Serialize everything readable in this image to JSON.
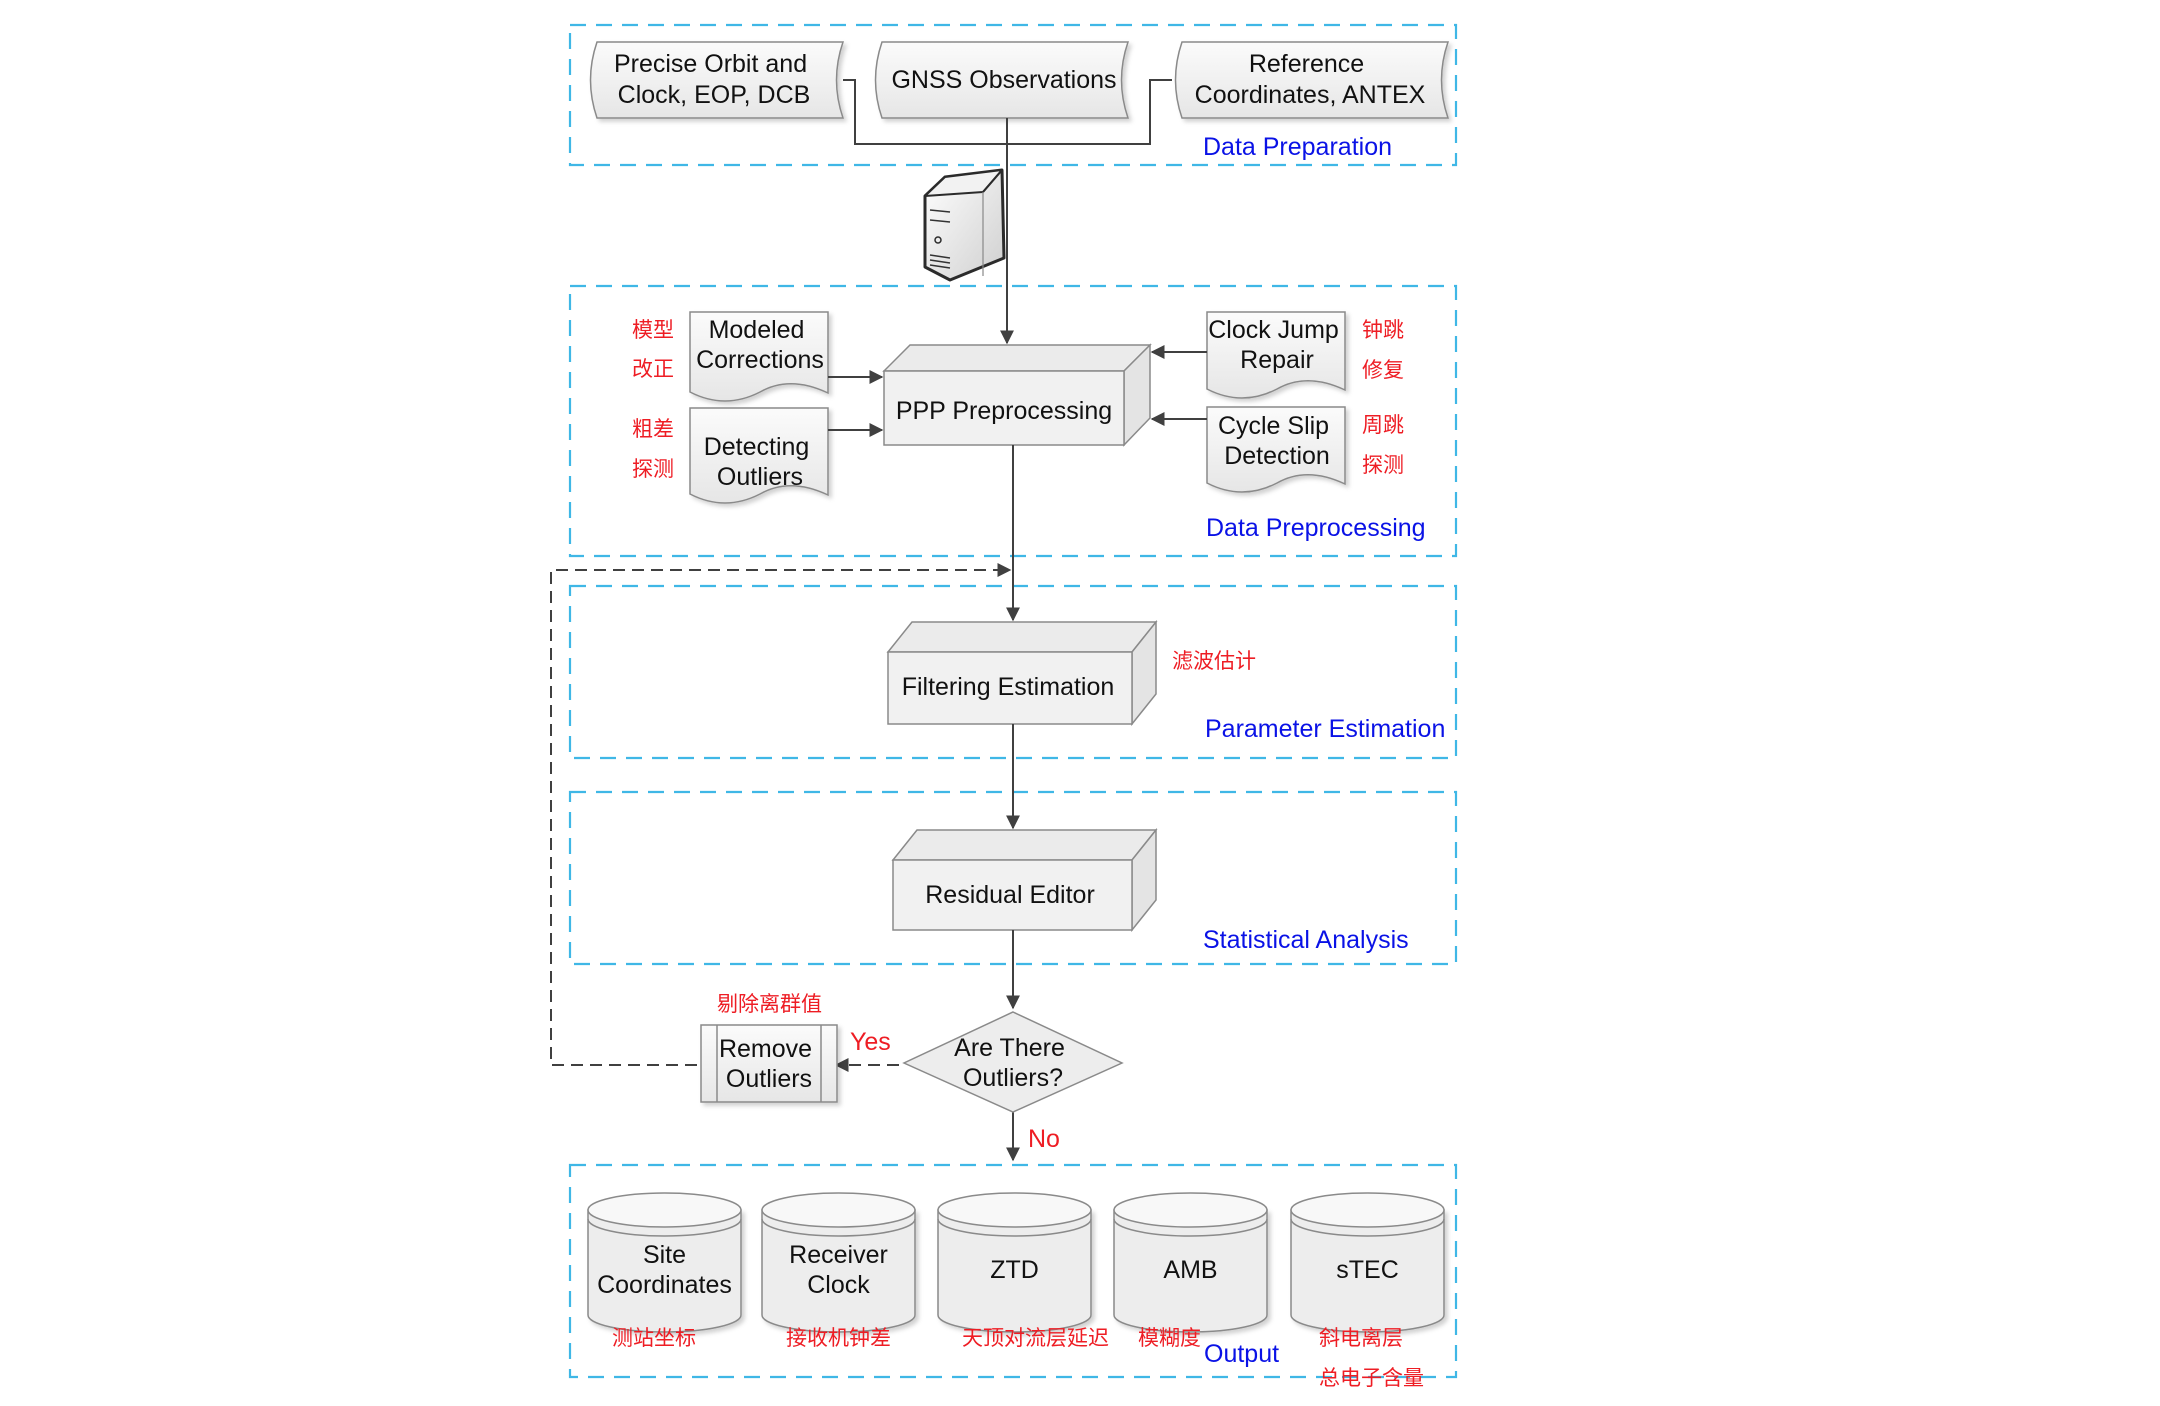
{
  "colors": {
    "section_border": "#3fb7e6",
    "section_label": "#0a12e6",
    "annotation": "#ee1d24",
    "shape_fill": "#f1f1f1",
    "connector": "#404040"
  },
  "sections": {
    "data_preparation": "Data Preparation",
    "data_preprocessing": "Data Preprocessing",
    "parameter_estimation": "Parameter Estimation",
    "statistical_analysis": "Statistical Analysis",
    "output": "Output"
  },
  "inputs": {
    "precise_orbit": [
      "Precise Orbit and",
      "Clock, EOP, DCB"
    ],
    "gnss_observations": [
      "GNSS Observations"
    ],
    "reference_coordinates": [
      "Reference",
      "Coordinates, ANTEX"
    ]
  },
  "server_icon": "server-icon",
  "preprocessing": {
    "main": "PPP Preprocessing",
    "modeled_corrections": [
      "Modeled",
      "Corrections"
    ],
    "modeled_corrections_cn": [
      "模型",
      "改正"
    ],
    "detecting_outliers": [
      "Detecting",
      "Outliers"
    ],
    "detecting_outliers_cn": [
      "粗差",
      "探测"
    ],
    "clock_jump": [
      "Clock Jump",
      "Repair"
    ],
    "clock_jump_cn": [
      "钟跳",
      "修复"
    ],
    "cycle_slip": [
      "Cycle Slip",
      "Detection"
    ],
    "cycle_slip_cn": [
      "周跳",
      "探测"
    ]
  },
  "estimation": {
    "main": "Filtering Estimation",
    "cn": "滤波估计"
  },
  "analysis": {
    "main": "Residual Editor"
  },
  "decision": {
    "question": [
      "Are There",
      "Outliers?"
    ],
    "yes": "Yes",
    "no": "No",
    "remove": [
      "Remove",
      "Outliers"
    ],
    "remove_cn": "剔除离群值"
  },
  "outputs": [
    {
      "label": [
        "Site",
        "Coordinates"
      ],
      "cn": [
        "测站坐标"
      ]
    },
    {
      "label": [
        "Receiver",
        "Clock"
      ],
      "cn": [
        "接收机钟差"
      ]
    },
    {
      "label": [
        "ZTD"
      ],
      "cn": [
        "天顶对流层延迟"
      ]
    },
    {
      "label": [
        "AMB"
      ],
      "cn": [
        "模糊度"
      ]
    },
    {
      "label": [
        "sTEC"
      ],
      "cn": [
        "斜电离层",
        "总电子含量"
      ]
    }
  ]
}
